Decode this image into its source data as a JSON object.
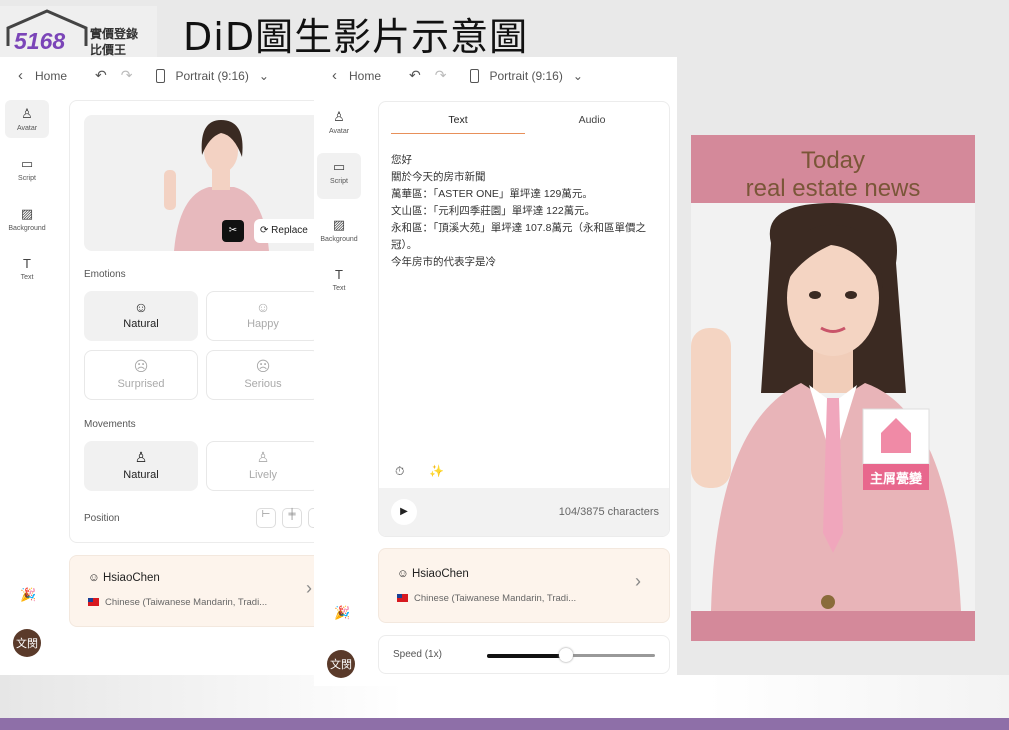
{
  "slide": {
    "title": "DiD圖生影片示意圖",
    "accent": "#8e6fa8"
  },
  "logo": {
    "number": "5168",
    "line1": "實價登錄",
    "line2": "比價王"
  },
  "left_panel": {
    "toolbar": {
      "home": "Home",
      "format": "Portrait (9:16)"
    },
    "nav": [
      {
        "label": "Avatar",
        "icon": "person-icon"
      },
      {
        "label": "Script",
        "icon": "speech-bubble-icon"
      },
      {
        "label": "Background",
        "icon": "hatch-icon"
      },
      {
        "label": "Text",
        "icon": "text-icon"
      }
    ],
    "replace_label": "Replace",
    "emotions_label": "Emotions",
    "emotions": [
      {
        "label": "Natural",
        "selected": true
      },
      {
        "label": "Happy"
      },
      {
        "label": "Surprised"
      },
      {
        "label": "Serious"
      }
    ],
    "movements_label": "Movements",
    "movements": [
      {
        "label": "Natural",
        "selected": true
      },
      {
        "label": "Lively"
      }
    ],
    "position_label": "Position",
    "voice": {
      "name": "HsiaoChen",
      "language": "Chinese (Taiwanese Mandarin, Tradi..."
    },
    "user_avatar": "文閔"
  },
  "middle_panel": {
    "toolbar": {
      "home": "Home",
      "format": "Portrait (9:16)"
    },
    "nav": [
      {
        "label": "Avatar"
      },
      {
        "label": "Script"
      },
      {
        "label": "Background"
      },
      {
        "label": "Text"
      }
    ],
    "tabs": [
      {
        "label": "Text",
        "active": true
      },
      {
        "label": "Audio"
      }
    ],
    "script": "您好\n關於今天的房市新聞\n萬華區：「ASTER ONE」單坪達 129萬元。\n文山區：「元利四季莊園」單坪達 122萬元。\n永和區：「頂溪大苑」單坪達 107.8萬元（永和區單價之冠）。\n今年房市的代表字是冷",
    "char_count": "104/3875 characters",
    "voice": {
      "name": "HsiaoChen",
      "language": "Chinese (Taiwanese Mandarin, Tradi..."
    },
    "speed_label": "Speed (1x)",
    "speed_value": 0.47,
    "user_avatar": "文閔"
  },
  "preview": {
    "line1": "Today",
    "line2": "real estate news",
    "badge": "主屑甍變",
    "bg": "#d4899a"
  }
}
